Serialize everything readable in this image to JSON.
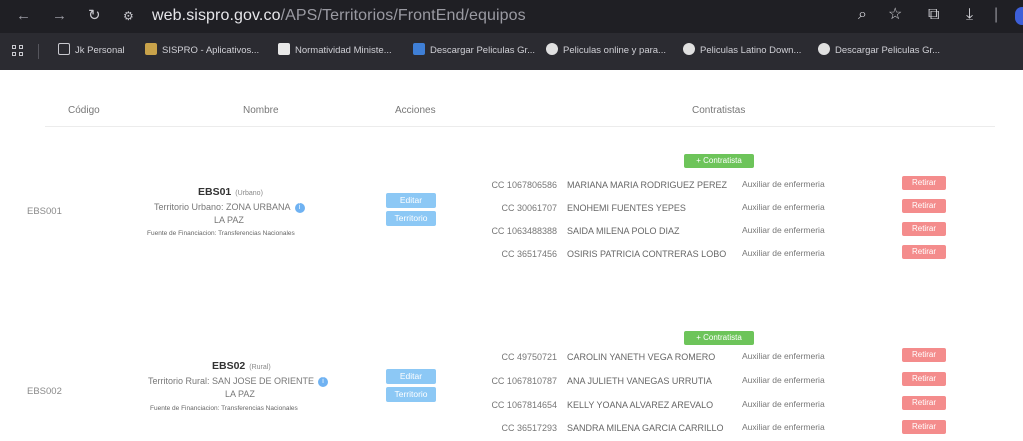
{
  "browser": {
    "url_host": "web.sispro.gov.co",
    "url_path": "/APS/Territorios/FrontEnd/equipos",
    "bookmarks": [
      {
        "label": "Jk Personal",
        "color": "#9aa0a6"
      },
      {
        "label": "SISPRO - Aplicativos...",
        "color": "#c8a24a"
      },
      {
        "label": "Normatividad Ministe...",
        "color": "#e8e8e8"
      },
      {
        "label": "Descargar Peliculas Gr...",
        "color": "#3f7fd6"
      },
      {
        "label": "Peliculas online y para...",
        "color": "#e0e0e0"
      },
      {
        "label": "Peliculas Latino Down...",
        "color": "#e0e0e0"
      },
      {
        "label": "Descargar Peliculas Gr...",
        "color": "#e0e0e0"
      }
    ]
  },
  "table": {
    "headers": {
      "codigo": "Código",
      "nombre": "Nombre",
      "acciones": "Acciones",
      "contratistas": "Contratistas"
    }
  },
  "teams": [
    {
      "code": "EBS001",
      "title": "EBS01",
      "type": "(Urbano)",
      "territory_line": "Territorio Urbano: ZONA URBANA",
      "municipality": "LA PAZ",
      "funding": "Fuente de Financiacion: Transferencias Nacionales",
      "edit_label": "Editar",
      "territory_label": "Territorio",
      "add_label": "+ Contratista",
      "contractors": [
        {
          "cc": "CC 1067806586",
          "name": "MARIANA MARIA RODRIGUEZ PEREZ",
          "role": "Auxiliar de enfermeria",
          "action": "Retirar"
        },
        {
          "cc": "CC 30061707",
          "name": "ENOHEMI FUENTES YEPES",
          "role": "Auxiliar de enfermeria",
          "action": "Retirar"
        },
        {
          "cc": "CC 1063488388",
          "name": "SAIDA MILENA POLO DIAZ",
          "role": "Auxiliar de enfermeria",
          "action": "Retirar"
        },
        {
          "cc": "CC 36517456",
          "name": "OSIRIS PATRICIA CONTRERAS LOBO",
          "role": "Auxiliar de enfermeria",
          "action": "Retirar"
        }
      ]
    },
    {
      "code": "EBS002",
      "title": "EBS02",
      "type": "(Rural)",
      "territory_line": "Territorio Rural: SAN JOSE DE ORIENTE",
      "municipality": "LA PAZ",
      "funding": "Fuente de Financiacion: Transferencias Nacionales",
      "edit_label": "Editar",
      "territory_label": "Territorio",
      "add_label": "+ Contratista",
      "contractors": [
        {
          "cc": "CC 49750721",
          "name": "CAROLIN YANETH VEGA ROMERO",
          "role": "Auxiliar de enfermeria",
          "action": "Retirar"
        },
        {
          "cc": "CC 1067810787",
          "name": "ANA JULIETH VANEGAS URRUTIA",
          "role": "Auxiliar de enfermeria",
          "action": "Retirar"
        },
        {
          "cc": "CC 1067814654",
          "name": "KELLY YOANA ALVAREZ AREVALO",
          "role": "Auxiliar de enfermeria",
          "action": "Retirar"
        },
        {
          "cc": "CC 36517293",
          "name": "SANDRA MILENA GARCIA CARRILLO",
          "role": "Auxiliar de enfermeria",
          "action": "Retirar"
        }
      ]
    }
  ]
}
